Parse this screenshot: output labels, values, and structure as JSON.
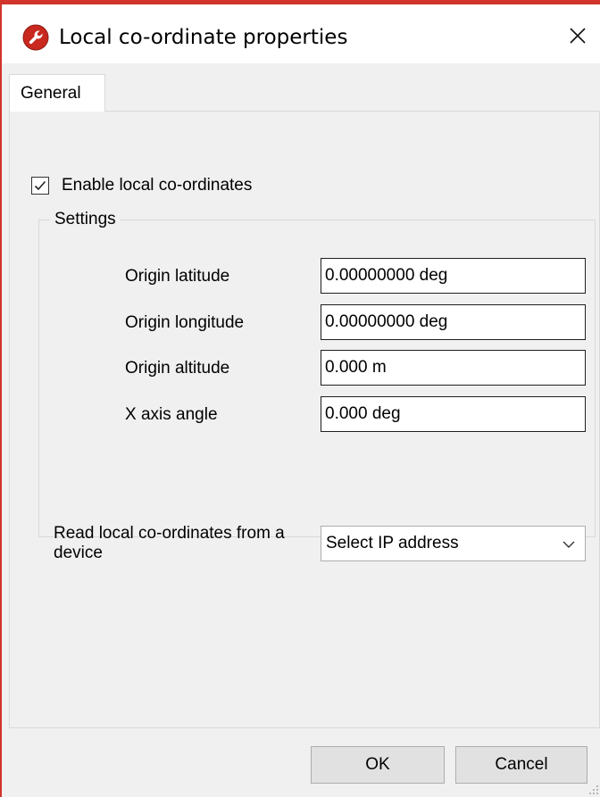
{
  "window": {
    "title": "Local co-ordinate properties",
    "close_glyph": "✕",
    "accent_color": "#d1342a"
  },
  "tabs": [
    {
      "label": "General",
      "selected": true
    }
  ],
  "enable_local": {
    "label": "Enable local co-ordinates",
    "checked": true
  },
  "settings": {
    "group_title": "Settings",
    "fields": [
      {
        "label": "Origin latitude",
        "value": "0.00000000 deg"
      },
      {
        "label": "Origin longitude",
        "value": "0.00000000 deg"
      },
      {
        "label": "Origin altitude",
        "value": "0.000 m"
      },
      {
        "label": "X axis angle",
        "value": "0.000 deg"
      }
    ],
    "read_device": {
      "label": "Read local co-ordinates from a device",
      "selected": "Select IP address"
    }
  },
  "buttons": {
    "ok": "OK",
    "cancel": "Cancel"
  },
  "icons": {
    "app": "wrench-badge-icon",
    "close": "close-icon",
    "checkbox": "checkmark-icon",
    "dropdown": "chevron-down-icon",
    "resize": "resize-grip-icon"
  }
}
